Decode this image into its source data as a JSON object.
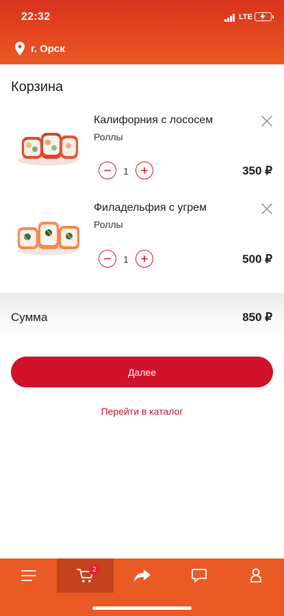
{
  "status_bar": {
    "time": "22:32",
    "network": "LTE"
  },
  "header": {
    "city": "г. Орск"
  },
  "cart": {
    "title": "Корзина",
    "items": [
      {
        "name": "Калифорния с лососем",
        "category": "Роллы",
        "quantity": "1",
        "price": "350 ₽"
      },
      {
        "name": "Филадельфия с угрем",
        "category": "Роллы",
        "quantity": "1",
        "price": "500 ₽"
      }
    ],
    "total_label": "Сумма",
    "total_value": "850 ₽",
    "next_button": "Далее",
    "catalog_link": "Перейти в каталог"
  },
  "tabbar": {
    "items": [
      "menu-icon",
      "cart-icon",
      "share-icon",
      "chat-icon",
      "profile-icon"
    ],
    "cart_badge": "2"
  },
  "colors": {
    "brand": "#ea5a24",
    "accent": "#d0122a",
    "active_tab": "#c4431d"
  }
}
